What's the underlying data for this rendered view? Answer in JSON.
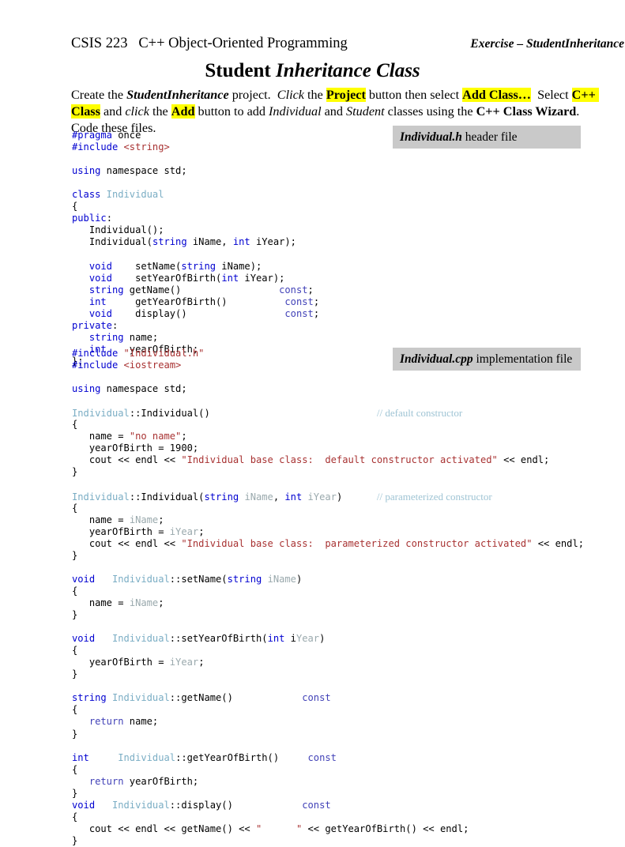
{
  "header": {
    "course_left": "CSIS 223   C++ Object-Oriented Programming",
    "exercise_right": "Exercise – StudentInheritance"
  },
  "title": {
    "plain": "Student ",
    "italic": "Inheritance Class"
  },
  "intro": {
    "t1": "Create the ",
    "t2": "StudentInheritance",
    "t3": " project.  ",
    "t4": "Click",
    "t5": " the ",
    "t6": "Project",
    "t7": " button then select ",
    "t8": "Add Class…",
    "t9": "  Select ",
    "t10": "C++ Class",
    "t11": " and ",
    "t12": "click",
    "t13": " the ",
    "t14": "Add",
    "t15": " button to add ",
    "t16": "Individual",
    "t17": " and ",
    "t18": "Student",
    "t19": " classes using the ",
    "t20": "C++ Class Wizard",
    "t21": ".  Code these files."
  },
  "fileboxes": {
    "header_name": "Individual.h",
    "header_desc": " header file",
    "cpp_name": "Individual.cpp",
    "cpp_desc": " implementation file"
  },
  "colors": {
    "keyword": "#0000d0",
    "type": "#7aadc4",
    "string": "#a83232",
    "const_return": "#4242b8",
    "param": "#9aa9ad",
    "comment": "#9fc4d4",
    "highlight": "#ffff00",
    "filebox_bg": "#c9c9c9"
  },
  "code_header": {
    "l01_pp": "#pragma",
    "l01_rest": " once",
    "l02_pp": "#include",
    "l02_str": " <string>",
    "l04_k": "using",
    "l04_rest": " namespace std;",
    "l06_k": "class",
    "l06_typ": " Individual",
    "l07": "{",
    "l08_k": "public",
    "l08_rest": ":",
    "l09": "   Individual();",
    "l10_a": "   Individual(",
    "l10_k": "string",
    "l10_b": " iName, ",
    "l10_k2": "int",
    "l10_c": " iYear);",
    "l12_k": "   void",
    "l12_a": "    setName(",
    "l12_k2": "string",
    "l12_b": " iName);",
    "l13_k": "   void",
    "l13_a": "    setYearOfBirth(",
    "l13_k2": "int",
    "l13_b": " iYear);",
    "l14_k": "   string",
    "l14_a": " getName()                 ",
    "l14_c": "const",
    "l14_b": ";",
    "l15_k": "   int",
    "l15_a": "     getYearOfBirth()          ",
    "l15_c": "const",
    "l15_b": ";",
    "l16_k": "   void",
    "l16_a": "    display()                 ",
    "l16_c": "const",
    "l16_b": ";",
    "l17_k": "private",
    "l17_rest": ":",
    "l18_k": "   string",
    "l18_rest": " name;",
    "l19_k": "   int",
    "l19_rest": "    yearOfBirth;",
    "l20": "};"
  },
  "code_cpp": {
    "l01_pp": "#include",
    "l01_str": " \"Individual.h\"",
    "l02_pp": "#include",
    "l02_str": " <iostream>",
    "l04_k": "using",
    "l04_rest": " namespace std;",
    "l06_typ": "Individual",
    "l06_rest": "::Individual()",
    "l06_pad": "                             ",
    "l06_cmt": "// default constructor",
    "l07": "{",
    "l08_a": "   name = ",
    "l08_str": "\"no name\"",
    "l08_b": ";",
    "l09": "   yearOfBirth = 1900;",
    "l10_a": "   cout << endl << ",
    "l10_str": "\"Individual base class:  default constructor activated\"",
    "l10_b": " << endl;",
    "l11": "}",
    "l13_typ": "Individual",
    "l13_a": "::Individual(",
    "l13_k": "string",
    "l13_b": " ",
    "l13_p": "iName",
    "l13_c": ", ",
    "l13_k2": "int",
    "l13_d": " ",
    "l13_p2": "iYear",
    "l13_e": ")",
    "l13_pad": "      ",
    "l13_cmt": "// parameterized constructor",
    "l14": "{",
    "l15_a": "   name = ",
    "l15_p": "iName",
    "l15_b": ";",
    "l16_a": "   yearOfBirth = ",
    "l16_p": "iYear",
    "l16_b": ";",
    "l17_a": "   cout << endl << ",
    "l17_str": "\"Individual base class:  parameterized constructor activated\"",
    "l17_b": " << endl;",
    "l18": "}",
    "l20_k": "void",
    "l20_a": "   ",
    "l20_typ": "Individual",
    "l20_b": "::setName(",
    "l20_k2": "string",
    "l20_c": " ",
    "l20_p": "iName",
    "l20_d": ")",
    "l21": "{",
    "l22_a": "   name = ",
    "l22_p": "iName",
    "l22_b": ";",
    "l23": "}",
    "l25_k": "void",
    "l25_a": "   ",
    "l25_typ": "Individual",
    "l25_b": "::setYearOfBirth(",
    "l25_k2": "int",
    "l25_c": " i",
    "l25_p": "Year",
    "l25_d": ")",
    "l26": "{",
    "l27_a": "   yearOfBirth = ",
    "l27_p": "iYear",
    "l27_b": ";",
    "l28": "}",
    "l30_k": "string",
    "l30_a": " ",
    "l30_typ": "Individual",
    "l30_b": "::getName()            ",
    "l30_c": "const",
    "l31": "{",
    "l32_k": "   return",
    "l32_rest": " name;",
    "l33": "}",
    "l35_k": "int",
    "l35_a": "     ",
    "l35_typ": "Individual",
    "l35_b": "::getYearOfBirth()     ",
    "l35_c": "const",
    "l36": "{",
    "l37_k": "   return",
    "l37_rest": " yearOfBirth;",
    "l38": "}",
    "l39_k": "void",
    "l39_a": "   ",
    "l39_typ": "Individual",
    "l39_b": "::display()            ",
    "l39_c": "const",
    "l40": "{",
    "l41_a": "   cout << endl << getName() << ",
    "l41_str": "\"      \"",
    "l41_b": " << getYearOfBirth() << endl;",
    "l42": "}"
  }
}
